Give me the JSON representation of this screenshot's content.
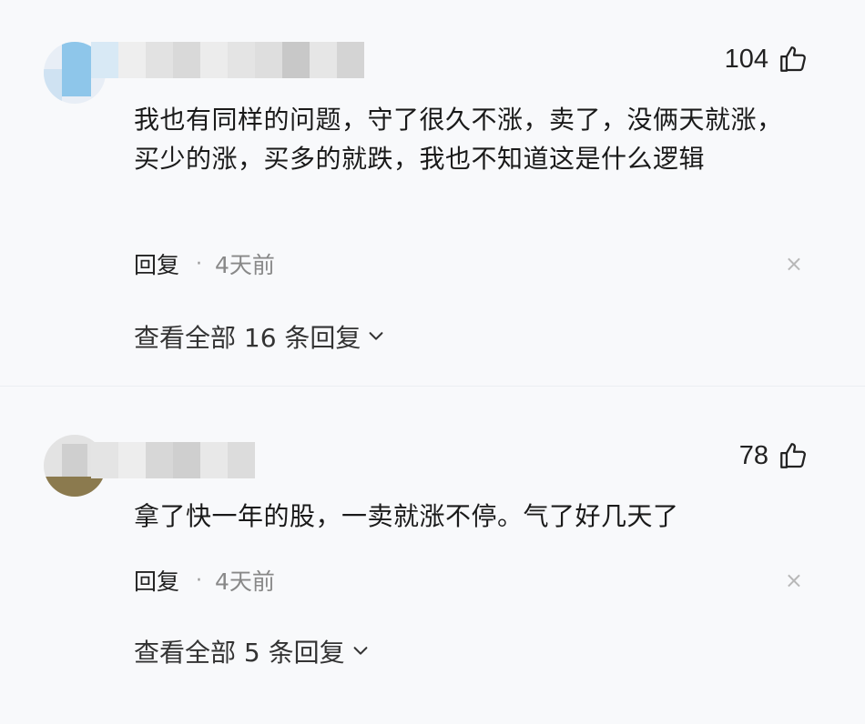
{
  "comments": [
    {
      "likes": "104",
      "text": "我也有同样的问题，守了很久不涨，卖了，没俩天就涨，买少的涨，买多的就跌，我也不知道这是什么逻辑",
      "reply_label": "回复",
      "separator": "·",
      "time": "4天前",
      "close": "×",
      "view_all": "查看全部 16 条回复"
    },
    {
      "likes": "78",
      "text": "拿了快一年的股，一卖就涨不停。气了好几天了",
      "reply_label": "回复",
      "separator": "·",
      "time": "4天前",
      "close": "×",
      "view_all": "查看全部 5 条回复"
    }
  ],
  "icons": {
    "like": "thumbs-up-icon",
    "close": "close-icon",
    "expand": "chevron-down-icon"
  },
  "colors": {
    "background": "#f8f9fb",
    "text": "#1a1a1a",
    "muted": "#888888"
  }
}
